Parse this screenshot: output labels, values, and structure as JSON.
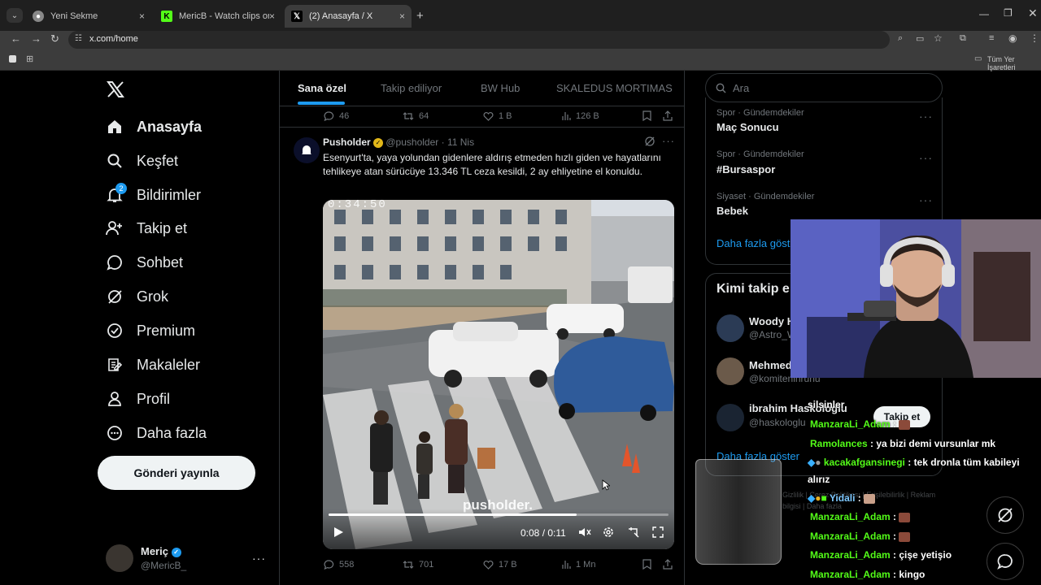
{
  "browser": {
    "tabs": [
      {
        "title": "Yeni Sekme",
        "icon": "chrome-icon"
      },
      {
        "title": "MericB - Watch clips on Kick",
        "icon": "kick-icon"
      },
      {
        "title": "(2) Anasayfa / X",
        "icon": "x-icon"
      }
    ],
    "url": "x.com/home",
    "bookmarks_label": "Tüm Yer İşaretleri"
  },
  "nav": {
    "items": [
      {
        "label": "Anasayfa",
        "icon": "home-icon"
      },
      {
        "label": "Keşfet",
        "icon": "search-icon"
      },
      {
        "label": "Bildirimler",
        "icon": "bell-icon",
        "badge": "2"
      },
      {
        "label": "Takip et",
        "icon": "follow-icon"
      },
      {
        "label": "Sohbet",
        "icon": "chat-icon"
      },
      {
        "label": "Grok",
        "icon": "grok-icon"
      },
      {
        "label": "Premium",
        "icon": "premium-icon"
      },
      {
        "label": "Makaleler",
        "icon": "articles-icon"
      },
      {
        "label": "Profil",
        "icon": "profile-icon"
      },
      {
        "label": "Daha fazla",
        "icon": "more-icon"
      }
    ],
    "post_button": "Gönderi yayınla",
    "account": {
      "name": "Meriç",
      "handle": "@MericB_"
    }
  },
  "feed": {
    "tabs": [
      "Sana özel",
      "Takip ediliyor",
      "BW Hub",
      "SKALEDUS MORTIMAS"
    ],
    "prev_post_actions": {
      "replies": "46",
      "reposts": "64",
      "likes": "1 B",
      "views": "126 B"
    },
    "post": {
      "author": "Pusholder",
      "handle": "@pusholder",
      "date": "11 Nis",
      "text": "Esenyurt'ta, yaya yolundan gidenlere aldırış etmeden hızlı giden ve hayatlarını tehlikeye atan sürücüye 13.346 TL ceza kesildi, 2 ay ehliyetine el konuldu.",
      "video_timestamp": "0:34:50",
      "watermark": "pusholder.",
      "video_time": "0:08 / 0:11",
      "video_progress": 0.73,
      "actions": {
        "replies": "558",
        "reposts": "701",
        "likes": "17 B",
        "views": "1 Mn"
      }
    }
  },
  "right": {
    "search_placeholder": "Ara",
    "trends": [
      {
        "category": "Spor · Gündemdekiler",
        "name": "Maç Sonucu"
      },
      {
        "category": "Spor · Gündemdekiler",
        "name": "#Bursaspor"
      },
      {
        "category": "Siyaset · Gündemdekiler",
        "name": "Bebek"
      }
    ],
    "show_more": "Daha fazla göster",
    "who_to_follow_title": "Kimi takip e",
    "suggestions": [
      {
        "name": "Woody H",
        "handle": "@Astro_W"
      },
      {
        "name": "Mehmed",
        "handle": "@komiteninruhu"
      },
      {
        "name": "ibrahim Haskologlu",
        "handle": "@haskologlu"
      }
    ],
    "follow_button": "Takip et",
    "show_more2": "Daha fazla göster",
    "footer": [
      "Gizlilik",
      "Çerez Politikası",
      "Erişilebilirlik",
      "Reklam bilgisi",
      "Daha fazla"
    ]
  },
  "stream_chat": [
    {
      "user": "",
      "message": "silsinler"
    },
    {
      "user": "ManzaraLi_Adam",
      "message": ""
    },
    {
      "user": "Ramolances",
      "message": "ya bizi demi vursunlar mk"
    },
    {
      "user": "kacakafgansinegi",
      "message": "tek dronla tüm kabileyi"
    },
    {
      "user": "",
      "message": "alırız"
    },
    {
      "user": "Yidali",
      "message": ""
    },
    {
      "user": "ManzaraLi_Adam",
      "message": ""
    },
    {
      "user": "ManzaraLi_Adam",
      "message": ""
    },
    {
      "user": "ManzaraLi_Adam",
      "message": "çişe yetişio"
    },
    {
      "user": "ManzaraLi_Adam",
      "message": "kingo"
    }
  ]
}
